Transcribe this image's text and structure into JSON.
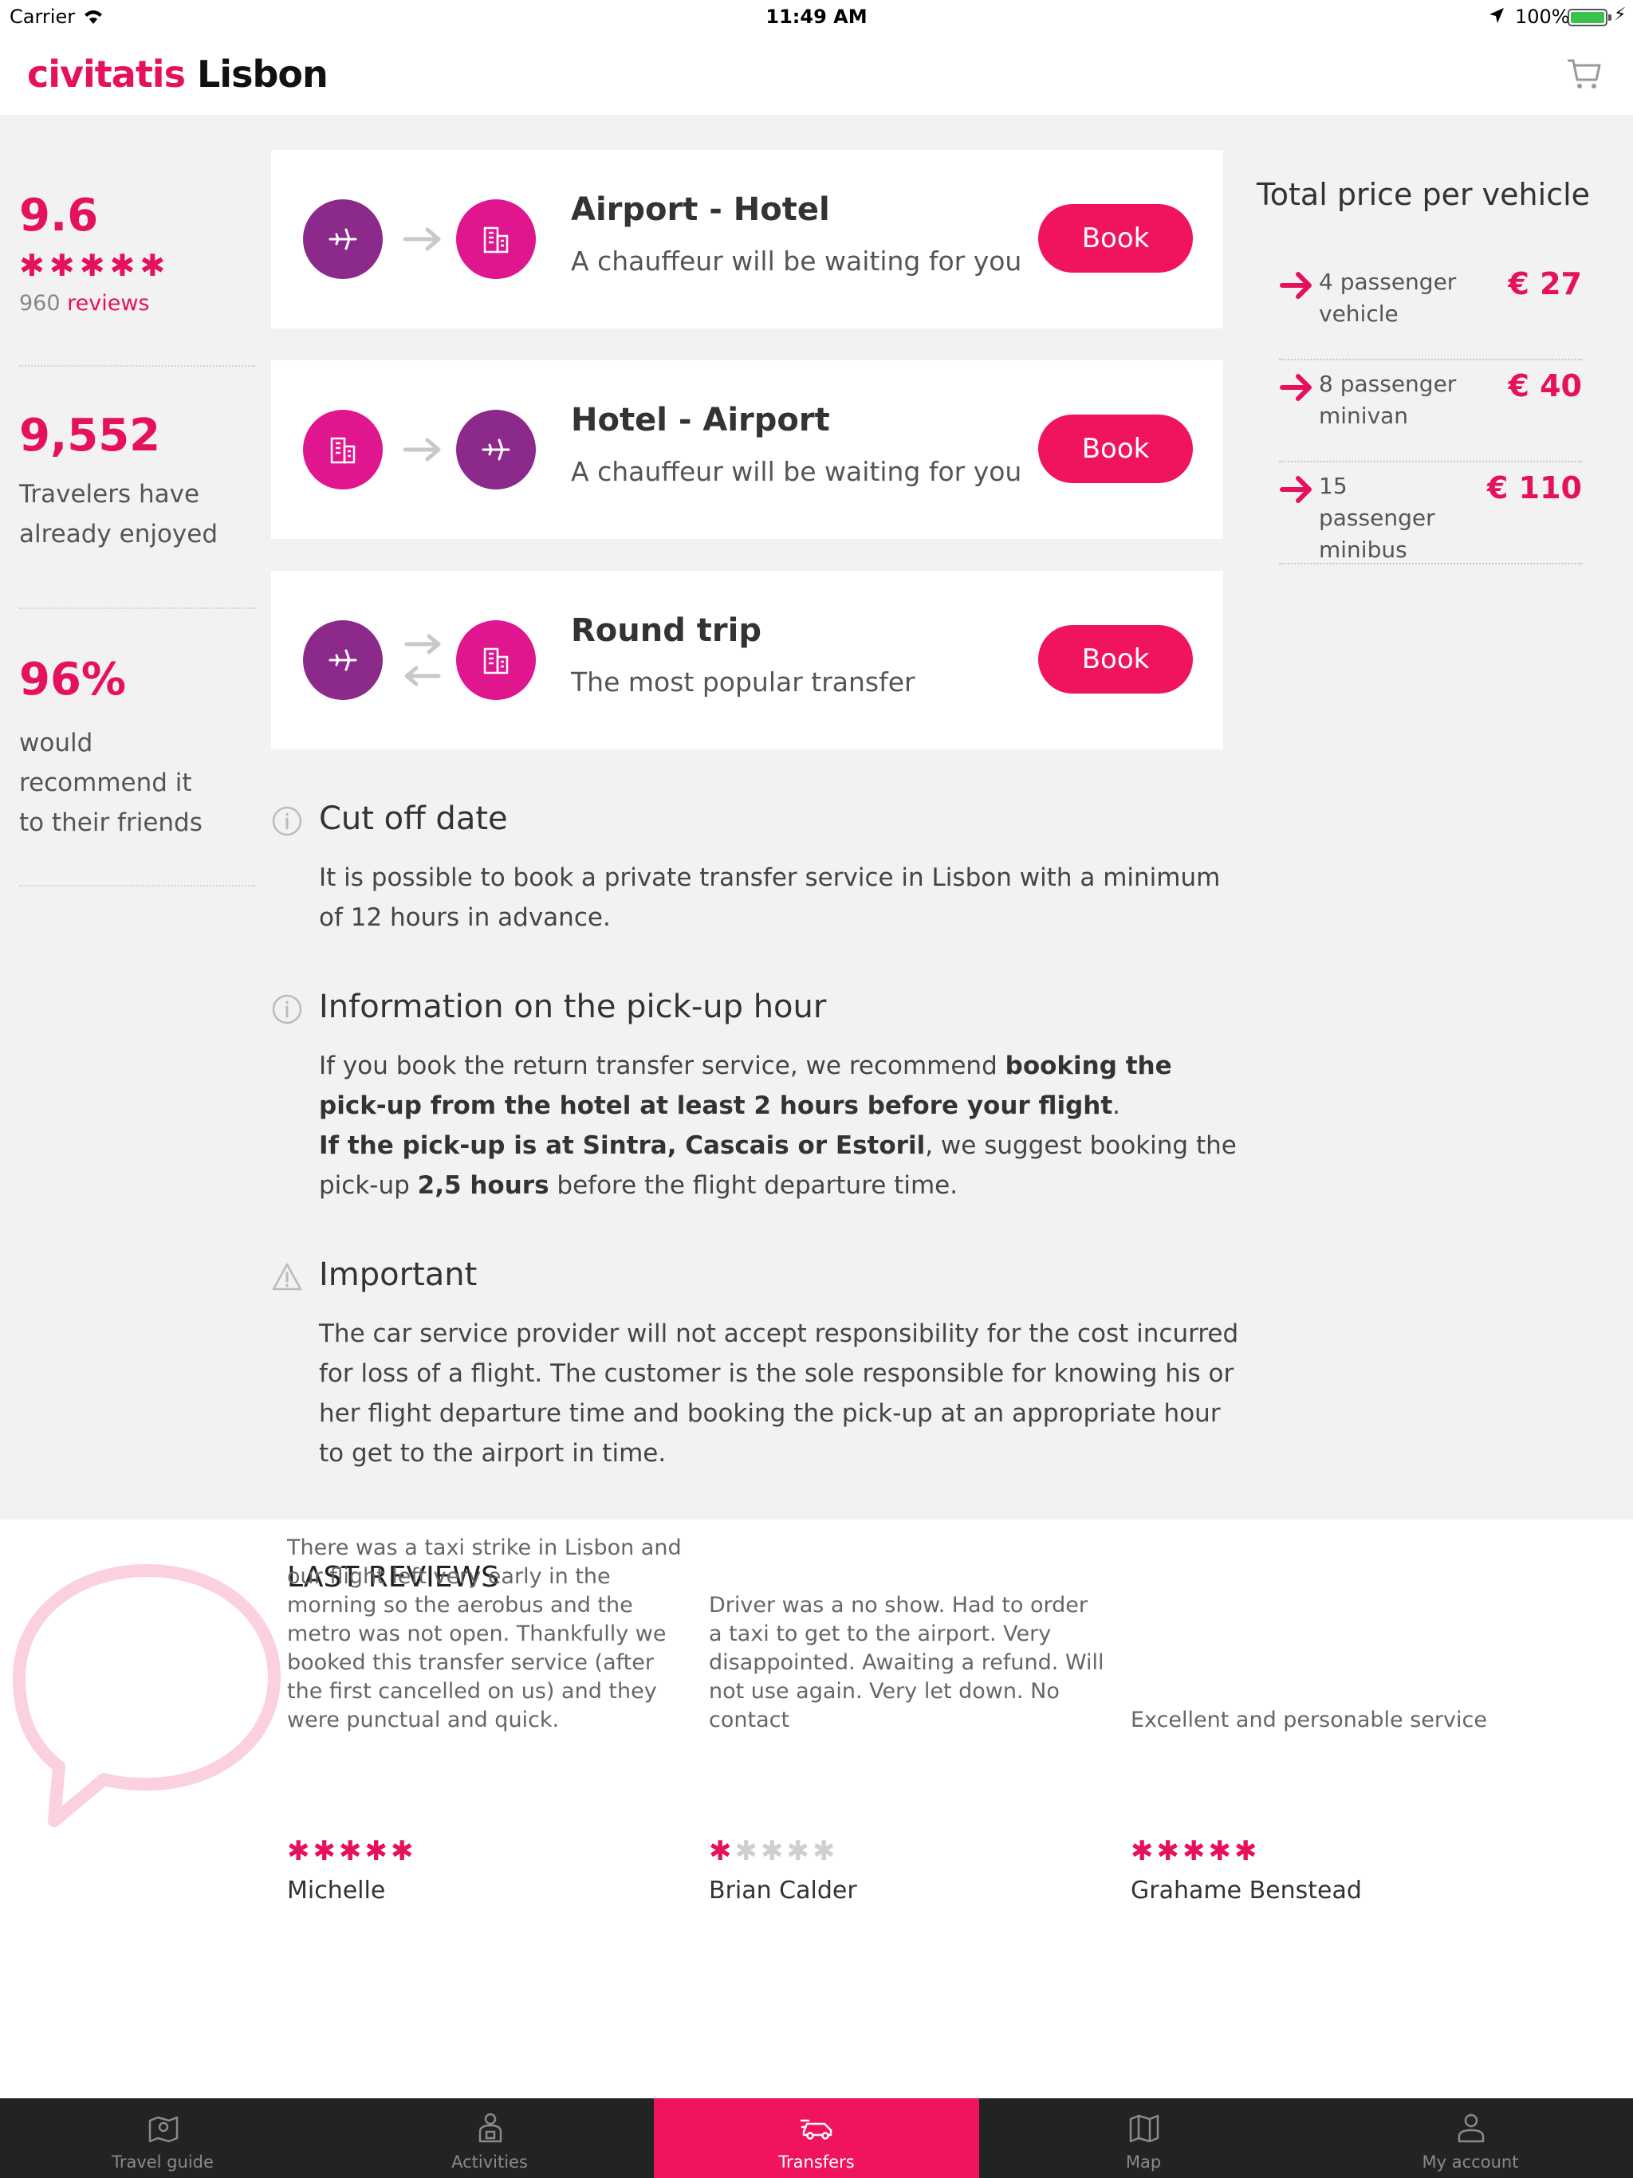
{
  "status_bar": {
    "carrier": "Carrier",
    "time": "11:49 AM",
    "battery": "100%"
  },
  "header": {
    "brand": "civitatis",
    "city": "Lisbon"
  },
  "stats": {
    "rating": "9.6",
    "review_count": "960",
    "review_word": "reviews",
    "travelers": "9,552",
    "travelers_text_1": "Travelers have",
    "travelers_text_2": "already enjoyed",
    "recommend_pct": "96%",
    "recommend_text_1": "would",
    "recommend_text_2": "recommend it",
    "recommend_text_3": "to their friends"
  },
  "transfers": [
    {
      "title": "Airport - Hotel",
      "subtitle": "A chauffeur will be waiting for you",
      "button": "Book"
    },
    {
      "title": "Hotel - Airport",
      "subtitle": "A chauffeur will be waiting for you",
      "button": "Book"
    },
    {
      "title": "Round trip",
      "subtitle": "The most popular transfer",
      "button": "Book"
    }
  ],
  "prices": {
    "title": "Total price per vehicle",
    "rows": [
      {
        "label_1": "4 passenger",
        "label_2": "vehicle",
        "price": "€ 27"
      },
      {
        "label_1": "8 passenger",
        "label_2": "minivan",
        "price": "€ 40"
      },
      {
        "label_1": "15 passenger",
        "label_2": "minibus",
        "price": "€ 110"
      }
    ]
  },
  "info": {
    "cutoff_title": "Cut off date",
    "cutoff_body": "It is possible to book a private transfer service in Lisbon with a minimum of 12 hours in advance.",
    "pickup_title": "Information on the pick-up hour",
    "pickup_p1_a": "If you book the return transfer service, we recommend ",
    "pickup_p1_b": "booking the pick-up from the hotel at least 2 hours before your flight",
    "pickup_p1_c": ".",
    "pickup_p2_a": "If the pick-up is at Sintra, Cascais or Estoril",
    "pickup_p2_b": ", we suggest booking the pick-up ",
    "pickup_p2_c": "2,5 hours",
    "pickup_p2_d": " before the flight departure time.",
    "important_title": "Important",
    "important_body": "The car service provider will not accept responsibility for the cost incurred for loss of a flight. The customer is the sole responsible for knowing his or her flight departure time and booking the pick-up at an appropriate hour to get to the airport in time."
  },
  "reviews": {
    "title": "LAST REVIEWS",
    "items": [
      {
        "text": "There was a taxi strike in Lisbon and our flight left very early in the morning so the aerobus and the metro was not open. Thankfully we booked this transfer service (after the first cancelled on us) and they were punctual and quick.",
        "rating": 5,
        "name": "Michelle"
      },
      {
        "text": "Driver was a no show. Had to order a taxi to get to the airport. Very disappointed. Awaiting a refund. Will not use again. Very let down. No contact",
        "rating": 1,
        "name": "Brian Calder"
      },
      {
        "text": "Excellent and personable service",
        "rating": 5,
        "name": "Grahame Benstead"
      }
    ]
  },
  "tabs": [
    {
      "label": "Travel guide",
      "icon": "map-pin-icon"
    },
    {
      "label": "Activities",
      "icon": "person-icon"
    },
    {
      "label": "Transfers",
      "icon": "car-icon",
      "active": true
    },
    {
      "label": "Map",
      "icon": "map-icon"
    },
    {
      "label": "My account",
      "icon": "user-icon"
    }
  ],
  "colors": {
    "accent": "#e6115d",
    "button": "#f0145f",
    "plane_circle": "#8b2a8a",
    "hotel_circle": "#e0168e",
    "tabbar": "#232323"
  }
}
